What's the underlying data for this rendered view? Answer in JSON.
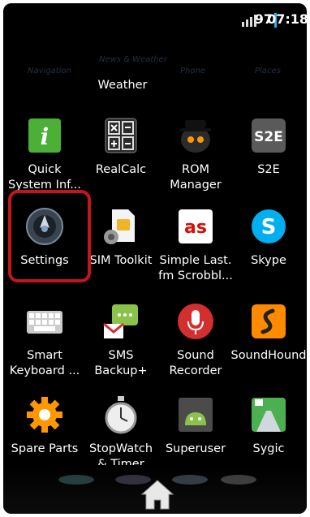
{
  "status": {
    "battery": "97",
    "time": "07:18",
    "battery_color": "#2ab3ff"
  },
  "ghost_row": [
    "Navigation",
    "News & Weather",
    "Phone",
    "Places"
  ],
  "partial_label": "Weather",
  "apps": [
    {
      "label_lines": [
        "Quick",
        "System Inf..."
      ],
      "icon": "info-icon"
    },
    {
      "label_lines": [
        "RealCalc"
      ],
      "icon": "calculator-icon"
    },
    {
      "label_lines": [
        "ROM",
        "Manager"
      ],
      "icon": "rom-manager-icon"
    },
    {
      "label_lines": [
        "S2E"
      ],
      "icon": "s2e-icon",
      "icon_text": "S2E"
    },
    {
      "label_lines": [
        "Settings"
      ],
      "icon": "settings-icon",
      "highlighted": true
    },
    {
      "label_lines": [
        "SIM Toolkit"
      ],
      "icon": "sim-card-icon"
    },
    {
      "label_lines": [
        "Simple Last.",
        "fm Scrobbl..."
      ],
      "icon": "lastfm-icon",
      "icon_text": "as"
    },
    {
      "label_lines": [
        "Skype"
      ],
      "icon": "skype-icon",
      "icon_text": "S"
    },
    {
      "label_lines": [
        "Smart",
        "Keyboard ..."
      ],
      "icon": "keyboard-icon"
    },
    {
      "label_lines": [
        "SMS",
        "Backup+"
      ],
      "icon": "sms-backup-icon"
    },
    {
      "label_lines": [
        "Sound",
        "Recorder"
      ],
      "icon": "microphone-icon"
    },
    {
      "label_lines": [
        "SoundHound"
      ],
      "icon": "soundhound-icon"
    },
    {
      "label_lines": [
        "Spare Parts"
      ],
      "icon": "gear-icon"
    },
    {
      "label_lines": [
        "StopWatch",
        "& Timer"
      ],
      "icon": "stopwatch-icon"
    },
    {
      "label_lines": [
        "Superuser"
      ],
      "icon": "android-icon"
    },
    {
      "label_lines": [
        "Sygic"
      ],
      "icon": "map-navigation-icon"
    }
  ],
  "dock": {
    "icon": "home-icon"
  }
}
